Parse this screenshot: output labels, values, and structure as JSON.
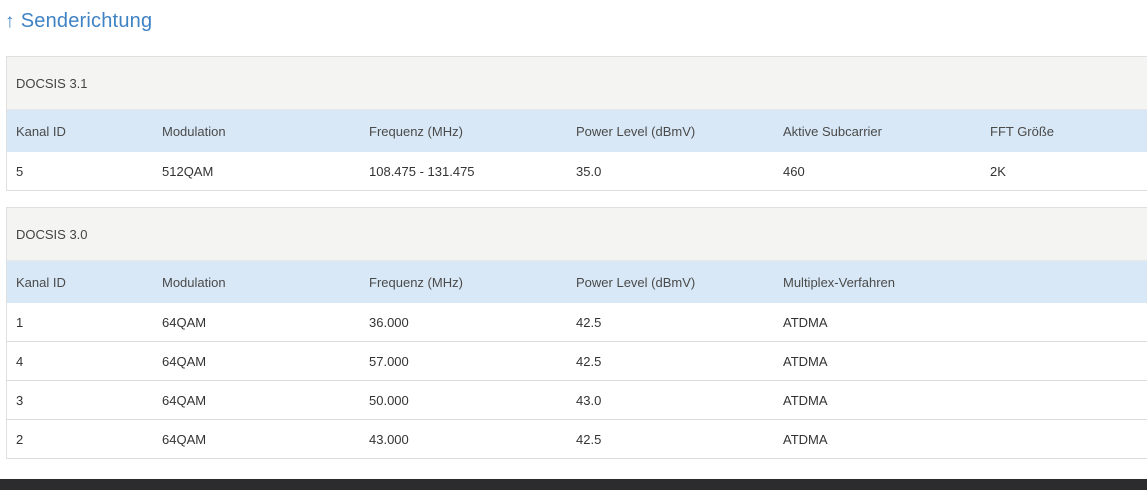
{
  "section": {
    "arrow": "↑",
    "title": "Senderichtung"
  },
  "docsis31": {
    "caption": "DOCSIS 3.1",
    "headers": [
      "Kanal ID",
      "Modulation",
      "Frequenz (MHz)",
      "Power Level (dBmV)",
      "Aktive Subcarrier",
      "FFT Größe"
    ],
    "rows": [
      [
        "5",
        "512QAM",
        "108.475 - 131.475",
        "35.0",
        "460",
        "2K"
      ]
    ]
  },
  "docsis30": {
    "caption": "DOCSIS 3.0",
    "headers": [
      "Kanal ID",
      "Modulation",
      "Frequenz (MHz)",
      "Power Level (dBmV)",
      "Multiplex-Verfahren"
    ],
    "rows": [
      [
        "1",
        "64QAM",
        "36.000",
        "42.5",
        "ATDMA"
      ],
      [
        "4",
        "64QAM",
        "57.000",
        "42.5",
        "ATDMA"
      ],
      [
        "3",
        "64QAM",
        "50.000",
        "43.0",
        "ATDMA"
      ],
      [
        "2",
        "64QAM",
        "43.000",
        "42.5",
        "ATDMA"
      ]
    ]
  }
}
